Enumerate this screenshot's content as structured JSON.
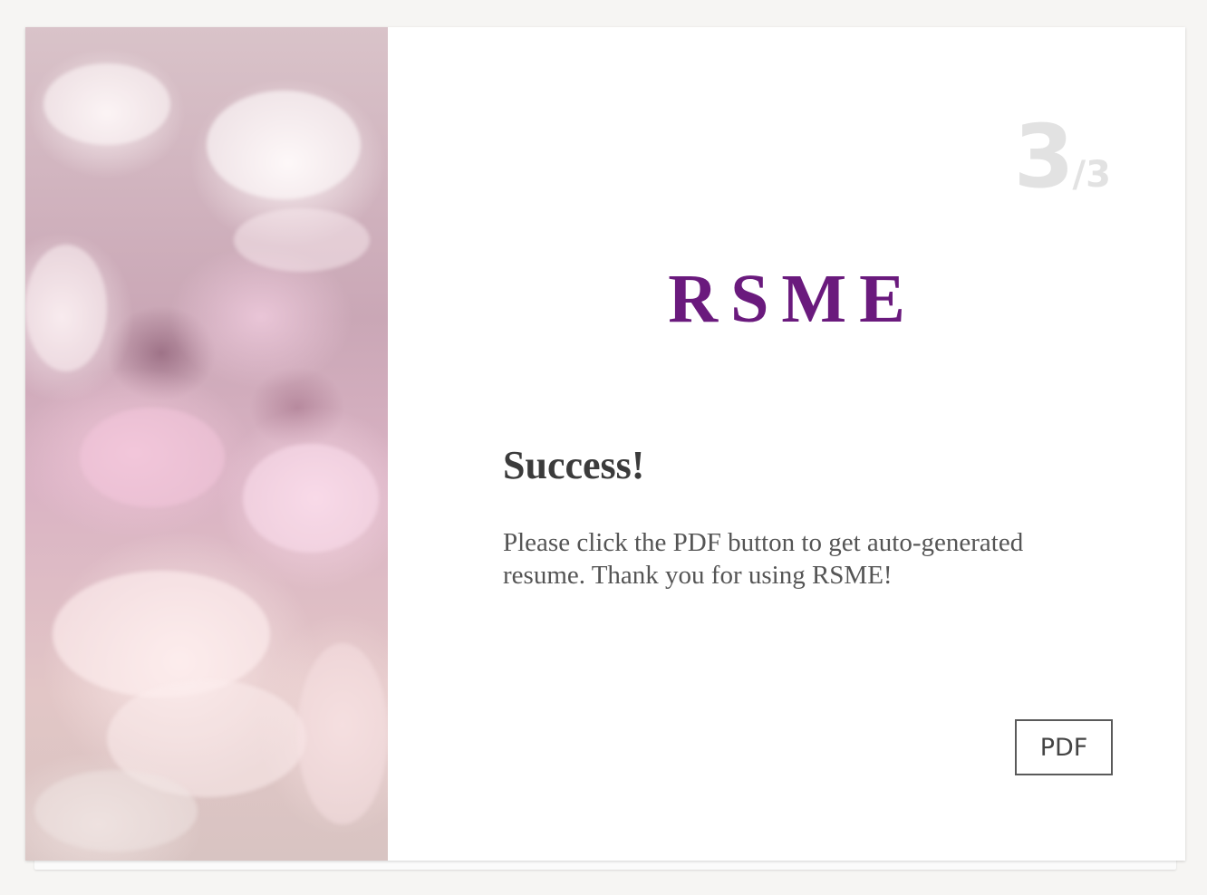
{
  "step": {
    "current": "3",
    "total": "/3"
  },
  "brand": {
    "name": "RSME",
    "color": "#6a1a7d"
  },
  "content": {
    "heading": "Success!",
    "message": "Please click the PDF button to get auto-generated resume. Thank you for using RSME!"
  },
  "actions": {
    "pdf_label": "PDF"
  },
  "image": {
    "subject": "pink and white peony flowers"
  }
}
